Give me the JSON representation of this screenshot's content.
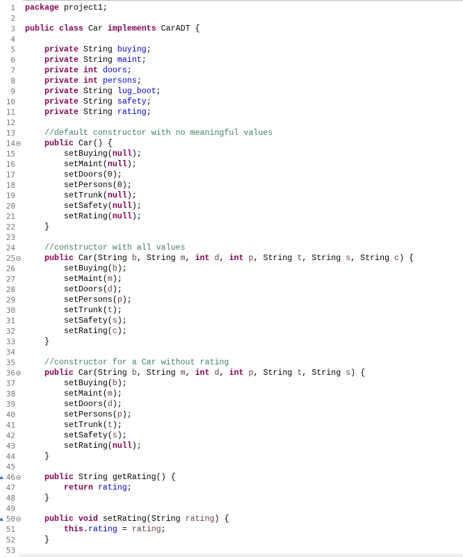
{
  "editor": {
    "language": "java",
    "colors": {
      "keyword": "#7f0055",
      "field": "#0000c0",
      "comment": "#3f7f5f",
      "parameter": "#6a3e3e",
      "line_number": "#787878"
    },
    "lines": [
      {
        "n": "1",
        "tokens": [
          [
            "kw",
            "package"
          ],
          [
            "plain",
            " project1;"
          ]
        ]
      },
      {
        "n": "2",
        "tokens": []
      },
      {
        "n": "3",
        "tokens": [
          [
            "kw",
            "public"
          ],
          [
            "plain",
            " "
          ],
          [
            "kw",
            "class"
          ],
          [
            "plain",
            " Car "
          ],
          [
            "kw",
            "implements"
          ],
          [
            "plain",
            " CarADT {"
          ]
        ]
      },
      {
        "n": "4",
        "tokens": []
      },
      {
        "n": "5",
        "tokens": [
          [
            "plain",
            "    "
          ],
          [
            "kw",
            "private"
          ],
          [
            "plain",
            " String "
          ],
          [
            "fld",
            "buying"
          ],
          [
            "plain",
            ";"
          ]
        ]
      },
      {
        "n": "6",
        "tokens": [
          [
            "plain",
            "    "
          ],
          [
            "kw",
            "private"
          ],
          [
            "plain",
            " String "
          ],
          [
            "fld",
            "maint"
          ],
          [
            "plain",
            ";"
          ]
        ]
      },
      {
        "n": "7",
        "tokens": [
          [
            "plain",
            "    "
          ],
          [
            "kw",
            "private"
          ],
          [
            "plain",
            " "
          ],
          [
            "kw",
            "int"
          ],
          [
            "plain",
            " "
          ],
          [
            "fld",
            "doors"
          ],
          [
            "plain",
            ";"
          ]
        ]
      },
      {
        "n": "8",
        "tokens": [
          [
            "plain",
            "    "
          ],
          [
            "kw",
            "private"
          ],
          [
            "plain",
            " "
          ],
          [
            "kw",
            "int"
          ],
          [
            "plain",
            " "
          ],
          [
            "fld",
            "persons"
          ],
          [
            "plain",
            ";"
          ]
        ]
      },
      {
        "n": "9",
        "tokens": [
          [
            "plain",
            "    "
          ],
          [
            "kw",
            "private"
          ],
          [
            "plain",
            " String "
          ],
          [
            "fld",
            "lug_boot"
          ],
          [
            "plain",
            ";"
          ]
        ]
      },
      {
        "n": "10",
        "tokens": [
          [
            "plain",
            "    "
          ],
          [
            "kw",
            "private"
          ],
          [
            "plain",
            " String "
          ],
          [
            "fld",
            "safety"
          ],
          [
            "plain",
            ";"
          ]
        ]
      },
      {
        "n": "11",
        "tokens": [
          [
            "plain",
            "    "
          ],
          [
            "kw",
            "private"
          ],
          [
            "plain",
            " String "
          ],
          [
            "fld",
            "rating"
          ],
          [
            "plain",
            ";"
          ]
        ]
      },
      {
        "n": "12",
        "tokens": []
      },
      {
        "n": "13",
        "tokens": [
          [
            "plain",
            "    "
          ],
          [
            "cmt",
            "//default constructor with no meaningful values"
          ]
        ]
      },
      {
        "n": "14",
        "fold": true,
        "tokens": [
          [
            "plain",
            "    "
          ],
          [
            "kw",
            "public"
          ],
          [
            "plain",
            " Car() {"
          ]
        ]
      },
      {
        "n": "15",
        "tokens": [
          [
            "plain",
            "        setBuying("
          ],
          [
            "kw",
            "null"
          ],
          [
            "plain",
            ");"
          ]
        ]
      },
      {
        "n": "16",
        "tokens": [
          [
            "plain",
            "        setMaint("
          ],
          [
            "kw",
            "null"
          ],
          [
            "plain",
            ");"
          ]
        ]
      },
      {
        "n": "17",
        "tokens": [
          [
            "plain",
            "        setDoors(0);"
          ]
        ]
      },
      {
        "n": "18",
        "tokens": [
          [
            "plain",
            "        setPersons(0);"
          ]
        ]
      },
      {
        "n": "19",
        "tokens": [
          [
            "plain",
            "        setTrunk("
          ],
          [
            "kw",
            "null"
          ],
          [
            "plain",
            ");"
          ]
        ]
      },
      {
        "n": "20",
        "tokens": [
          [
            "plain",
            "        setSafety("
          ],
          [
            "kw",
            "null"
          ],
          [
            "plain",
            ");"
          ]
        ]
      },
      {
        "n": "21",
        "tokens": [
          [
            "plain",
            "        setRating("
          ],
          [
            "kw",
            "null"
          ],
          [
            "plain",
            ");"
          ]
        ]
      },
      {
        "n": "22",
        "tokens": [
          [
            "plain",
            "    }"
          ]
        ]
      },
      {
        "n": "23",
        "tokens": []
      },
      {
        "n": "24",
        "tokens": [
          [
            "plain",
            "    "
          ],
          [
            "cmt",
            "//constructor with all values"
          ]
        ]
      },
      {
        "n": "25",
        "fold": true,
        "tokens": [
          [
            "plain",
            "    "
          ],
          [
            "kw",
            "public"
          ],
          [
            "plain",
            " Car(String "
          ],
          [
            "prm",
            "b"
          ],
          [
            "plain",
            ", String "
          ],
          [
            "prm",
            "m"
          ],
          [
            "plain",
            ", "
          ],
          [
            "kw",
            "int"
          ],
          [
            "plain",
            " "
          ],
          [
            "prm",
            "d"
          ],
          [
            "plain",
            ", "
          ],
          [
            "kw",
            "int"
          ],
          [
            "plain",
            " "
          ],
          [
            "prm",
            "p"
          ],
          [
            "plain",
            ", String "
          ],
          [
            "prm",
            "t"
          ],
          [
            "plain",
            ", String "
          ],
          [
            "prm",
            "s"
          ],
          [
            "plain",
            ", String "
          ],
          [
            "prm",
            "c"
          ],
          [
            "plain",
            ") {"
          ]
        ]
      },
      {
        "n": "26",
        "tokens": [
          [
            "plain",
            "        setBuying("
          ],
          [
            "prm",
            "b"
          ],
          [
            "plain",
            ");"
          ]
        ]
      },
      {
        "n": "27",
        "tokens": [
          [
            "plain",
            "        setMaint("
          ],
          [
            "prm",
            "m"
          ],
          [
            "plain",
            ");"
          ]
        ]
      },
      {
        "n": "28",
        "tokens": [
          [
            "plain",
            "        setDoors("
          ],
          [
            "prm",
            "d"
          ],
          [
            "plain",
            ");"
          ]
        ]
      },
      {
        "n": "29",
        "tokens": [
          [
            "plain",
            "        setPersons("
          ],
          [
            "prm",
            "p"
          ],
          [
            "plain",
            ");"
          ]
        ]
      },
      {
        "n": "30",
        "tokens": [
          [
            "plain",
            "        setTrunk("
          ],
          [
            "prm",
            "t"
          ],
          [
            "plain",
            ");"
          ]
        ]
      },
      {
        "n": "31",
        "tokens": [
          [
            "plain",
            "        setSafety("
          ],
          [
            "prm",
            "s"
          ],
          [
            "plain",
            ");"
          ]
        ]
      },
      {
        "n": "32",
        "tokens": [
          [
            "plain",
            "        setRating("
          ],
          [
            "prm",
            "c"
          ],
          [
            "plain",
            ");"
          ]
        ]
      },
      {
        "n": "33",
        "tokens": [
          [
            "plain",
            "    }"
          ]
        ]
      },
      {
        "n": "34",
        "tokens": []
      },
      {
        "n": "35",
        "tokens": [
          [
            "plain",
            "    "
          ],
          [
            "cmt",
            "//constructor for a Car without rating"
          ]
        ]
      },
      {
        "n": "36",
        "fold": true,
        "tokens": [
          [
            "plain",
            "    "
          ],
          [
            "kw",
            "public"
          ],
          [
            "plain",
            " Car(String "
          ],
          [
            "prm",
            "b"
          ],
          [
            "plain",
            ", String "
          ],
          [
            "prm",
            "m"
          ],
          [
            "plain",
            ", "
          ],
          [
            "kw",
            "int"
          ],
          [
            "plain",
            " "
          ],
          [
            "prm",
            "d"
          ],
          [
            "plain",
            ", "
          ],
          [
            "kw",
            "int"
          ],
          [
            "plain",
            " "
          ],
          [
            "prm",
            "p"
          ],
          [
            "plain",
            ", String "
          ],
          [
            "prm",
            "t"
          ],
          [
            "plain",
            ", String "
          ],
          [
            "prm",
            "s"
          ],
          [
            "plain",
            ") {"
          ]
        ]
      },
      {
        "n": "37",
        "tokens": [
          [
            "plain",
            "        setBuying("
          ],
          [
            "prm",
            "b"
          ],
          [
            "plain",
            ");"
          ]
        ]
      },
      {
        "n": "38",
        "tokens": [
          [
            "plain",
            "        setMaint("
          ],
          [
            "prm",
            "m"
          ],
          [
            "plain",
            ");"
          ]
        ]
      },
      {
        "n": "39",
        "tokens": [
          [
            "plain",
            "        setDoors("
          ],
          [
            "prm",
            "d"
          ],
          [
            "plain",
            ");"
          ]
        ]
      },
      {
        "n": "40",
        "tokens": [
          [
            "plain",
            "        setPersons("
          ],
          [
            "prm",
            "p"
          ],
          [
            "plain",
            ");"
          ]
        ]
      },
      {
        "n": "41",
        "tokens": [
          [
            "plain",
            "        setTrunk("
          ],
          [
            "prm",
            "t"
          ],
          [
            "plain",
            ");"
          ]
        ]
      },
      {
        "n": "42",
        "tokens": [
          [
            "plain",
            "        setSafety("
          ],
          [
            "prm",
            "s"
          ],
          [
            "plain",
            ");"
          ]
        ]
      },
      {
        "n": "43",
        "tokens": [
          [
            "plain",
            "        setRating("
          ],
          [
            "kw",
            "null"
          ],
          [
            "plain",
            ");"
          ]
        ]
      },
      {
        "n": "44",
        "tokens": [
          [
            "plain",
            "    }"
          ]
        ]
      },
      {
        "n": "45",
        "tokens": []
      },
      {
        "n": "46",
        "fold": true,
        "override": true,
        "tokens": [
          [
            "plain",
            "    "
          ],
          [
            "kw",
            "public"
          ],
          [
            "plain",
            " String getRating() {"
          ]
        ]
      },
      {
        "n": "47",
        "tokens": [
          [
            "plain",
            "        "
          ],
          [
            "kw",
            "return"
          ],
          [
            "plain",
            " "
          ],
          [
            "fld",
            "rating"
          ],
          [
            "plain",
            ";"
          ]
        ]
      },
      {
        "n": "48",
        "tokens": [
          [
            "plain",
            "    }"
          ]
        ]
      },
      {
        "n": "49",
        "tokens": []
      },
      {
        "n": "50",
        "fold": true,
        "override": true,
        "tokens": [
          [
            "plain",
            "    "
          ],
          [
            "kw",
            "public"
          ],
          [
            "plain",
            " "
          ],
          [
            "kw",
            "void"
          ],
          [
            "plain",
            " setRating(String "
          ],
          [
            "prm",
            "rating"
          ],
          [
            "plain",
            ") {"
          ]
        ]
      },
      {
        "n": "51",
        "tokens": [
          [
            "plain",
            "        "
          ],
          [
            "kw",
            "this"
          ],
          [
            "plain",
            "."
          ],
          [
            "fld",
            "rating"
          ],
          [
            "plain",
            " = "
          ],
          [
            "prm",
            "rating"
          ],
          [
            "plain",
            ";"
          ]
        ]
      },
      {
        "n": "52",
        "tokens": [
          [
            "plain",
            "    }"
          ]
        ]
      },
      {
        "n": "53",
        "tokens": []
      }
    ]
  }
}
